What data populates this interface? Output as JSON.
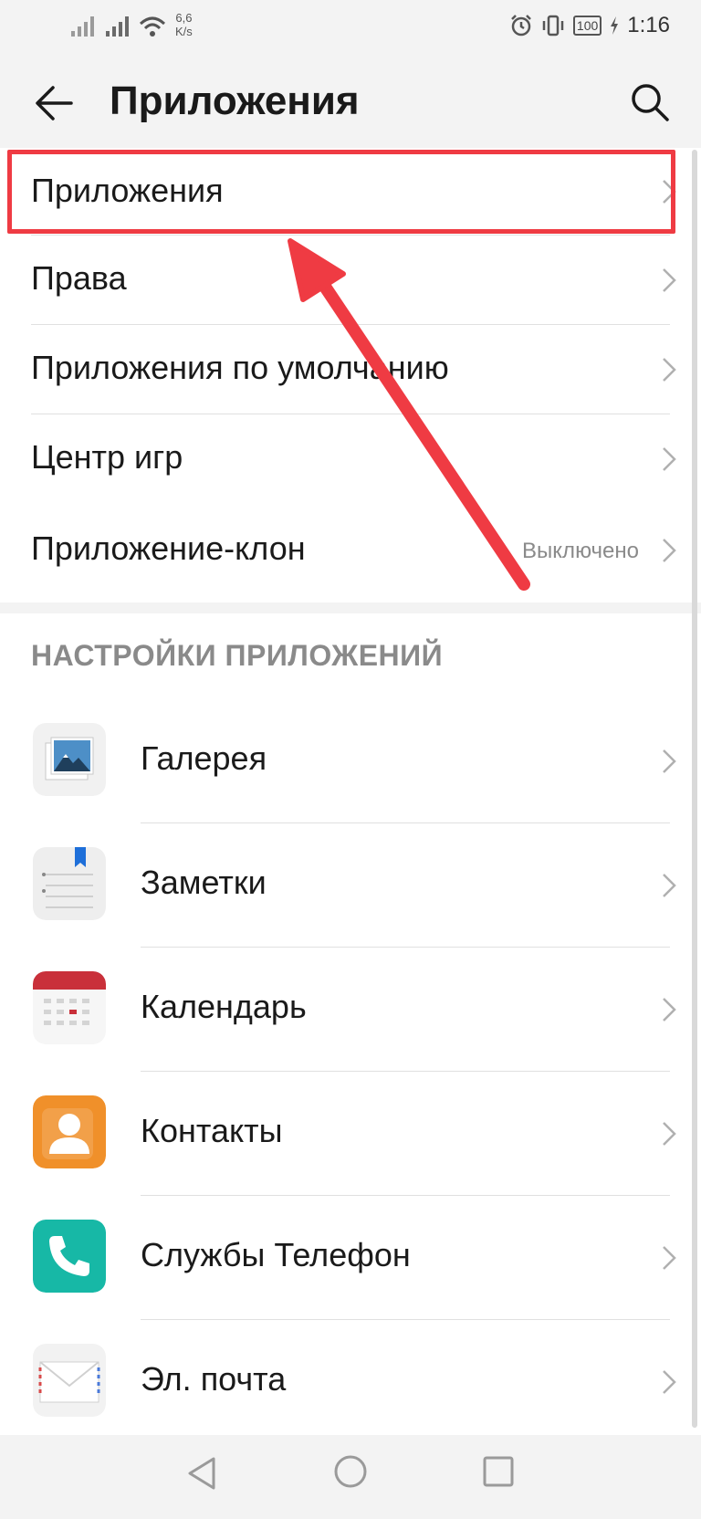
{
  "status_bar": {
    "speed_value": "6,6",
    "speed_unit": "K/s",
    "battery": "100",
    "time": "1:16"
  },
  "app_bar": {
    "title": "Приложения"
  },
  "menu": {
    "items": [
      {
        "label": "Приложения",
        "value": ""
      },
      {
        "label": "Права",
        "value": ""
      },
      {
        "label": "Приложения по умолчанию",
        "value": ""
      },
      {
        "label": "Центр игр",
        "value": ""
      },
      {
        "label": "Приложение-клон",
        "value": "Выключено"
      }
    ]
  },
  "settings": {
    "header": "НАСТРОЙКИ ПРИЛОЖЕНИЙ",
    "apps": [
      {
        "label": "Галерея",
        "icon": "gallery-icon"
      },
      {
        "label": "Заметки",
        "icon": "notes-icon"
      },
      {
        "label": "Календарь",
        "icon": "calendar-icon"
      },
      {
        "label": "Контакты",
        "icon": "contacts-icon"
      },
      {
        "label": "Службы Телефон",
        "icon": "phone-icon"
      },
      {
        "label": "Эл. почта",
        "icon": "email-icon"
      }
    ]
  },
  "annotation": {
    "color": "#ef3b43"
  }
}
